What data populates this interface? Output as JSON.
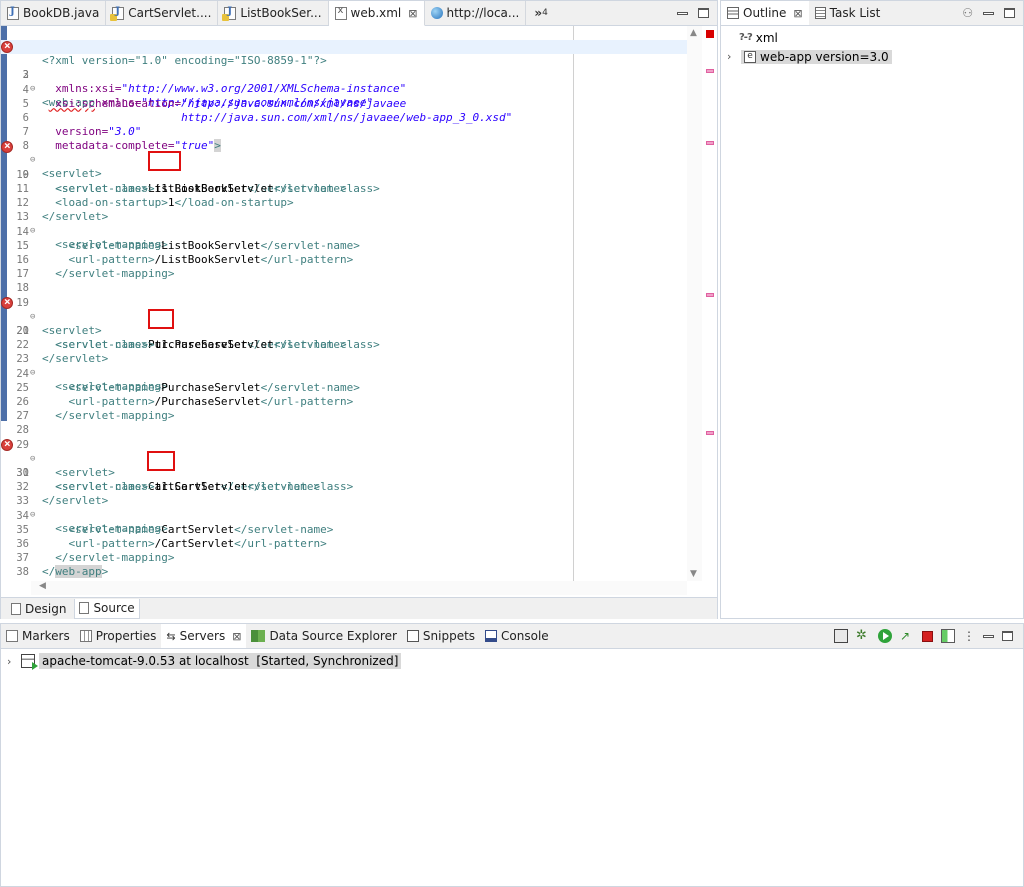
{
  "editor": {
    "tabs": [
      {
        "label": "BookDB.java",
        "icon": "java-file-icon"
      },
      {
        "label": "CartServlet....",
        "icon": "java-file-error-icon"
      },
      {
        "label": "ListBookSer...",
        "icon": "java-file-error-icon"
      },
      {
        "label": "web.xml",
        "icon": "xml-file-icon",
        "active": true,
        "close": "⊠"
      },
      {
        "label": "http://loca...",
        "icon": "globe-icon"
      }
    ],
    "overflow_label": "»",
    "overflow_count": "4",
    "bottom_tabs": {
      "design": "Design",
      "source": "Source"
    },
    "line_numbers": [
      "1",
      "2",
      "3",
      "4",
      "5",
      "6",
      "7",
      "8",
      "9",
      "10",
      "11",
      "12",
      "13",
      "14",
      "15",
      "16",
      "17",
      "18",
      "19",
      "20",
      "21",
      "22",
      "23",
      "24",
      "25",
      "26",
      "27",
      "28",
      "29",
      "30",
      "31",
      "32",
      "33",
      "34",
      "35",
      "36",
      "37",
      "38"
    ],
    "lines": {
      "l1": "<?xml version=\"1.0\" encoding=\"ISO-8859-1\"?>",
      "l2_tag": "web-app",
      "l2_attr": " xmlns=",
      "l2_val": "\"http://java.sun.com/xml/ns/javaee\"",
      "l3_attr": "xmlns:xsi=",
      "l3_val": "\"http://www.w3.org/2001/XMLSchema-instance\"",
      "l4_attr": "xsi:schemaLocation=",
      "l4_val": "\"http://java.sun.com/xml/ns/javaee",
      "l5_val": "http://java.sun.com/xml/ns/javaee/web-app_3_0.xsd\"",
      "l6_attr": "version=",
      "l6_val": "\"3.0\"",
      "l7_attr": "metadata-complete=",
      "l7_val": "\"true\"",
      "s1_name": "ListBookServlet",
      "s1_class": "t1.ListBookServlet",
      "s1_load": "1",
      "s1_pattern": "/ListBookServlet",
      "s2_name": "PurchaseServlet",
      "s2_class": "t1.PurchaseServlet",
      "s2_pattern": "/PurchaseServlet",
      "s3_name": "CartServlet",
      "s3_class": "t1.CartServlet",
      "s3_pattern": "/CartServlet",
      "end_tag": "web-app"
    }
  },
  "outline": {
    "tabs": [
      {
        "label": "Outline",
        "active": true,
        "close": "⊠"
      },
      {
        "label": "Task List"
      }
    ],
    "tree": [
      {
        "icon": "?-?",
        "label": "xml"
      },
      {
        "icon": "e",
        "label": "web-app version=3.0",
        "selected": true
      }
    ]
  },
  "bottom": {
    "tabs": [
      {
        "label": "Markers"
      },
      {
        "label": "Properties"
      },
      {
        "label": "Servers",
        "active": true,
        "close": "⊠"
      },
      {
        "label": "Data Source Explorer"
      },
      {
        "label": "Snippets"
      },
      {
        "label": "Console"
      }
    ],
    "server": {
      "name": "apache-tomcat-9.0.53 at localhost",
      "status": "[Started, Synchronized]"
    }
  },
  "colors": {
    "tag": "#3f7f7f",
    "attr": "#7f007f",
    "value": "#2a00ff",
    "error_box": "#e01010"
  }
}
